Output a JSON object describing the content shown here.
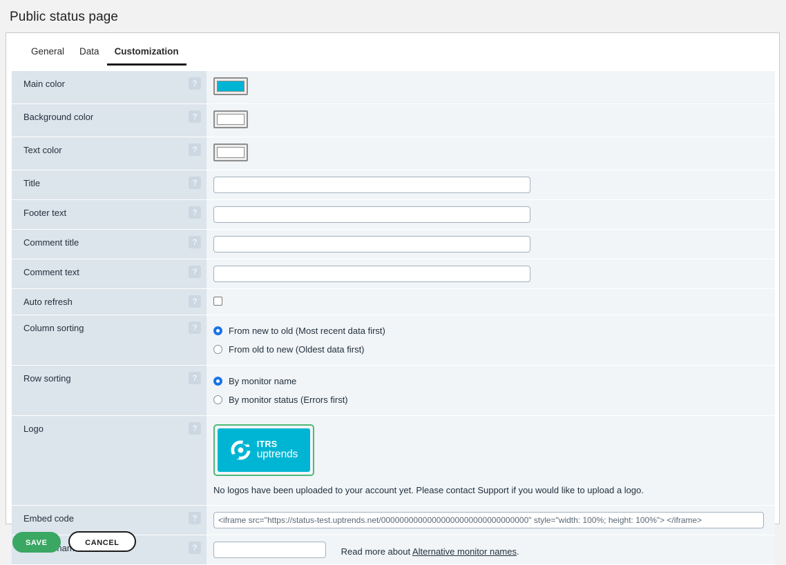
{
  "page": {
    "title": "Public status page"
  },
  "tabs": [
    {
      "label": "General",
      "active": false
    },
    {
      "label": "Data",
      "active": false
    },
    {
      "label": "Customization",
      "active": true
    }
  ],
  "help_icon_glyph": "?",
  "colors": {
    "main_color_value": "#00b5d4",
    "background_color_value": "#ffffff",
    "text_color_value": "#ffffff",
    "accent_green": "#3aa763",
    "radio_blue": "#1a73e8",
    "label_column_bg": "#dce4ec",
    "row_bg": "#f1f5f8"
  },
  "rows": {
    "main_color": {
      "label": "Main color"
    },
    "background_color": {
      "label": "Background color"
    },
    "text_color": {
      "label": "Text color"
    },
    "title": {
      "label": "Title",
      "value": "",
      "placeholder": ""
    },
    "footer_text": {
      "label": "Footer text",
      "value": "",
      "placeholder": ""
    },
    "comment_title": {
      "label": "Comment title",
      "value": "",
      "placeholder": ""
    },
    "comment_text": {
      "label": "Comment text",
      "value": "",
      "placeholder": ""
    },
    "auto_refresh": {
      "label": "Auto refresh",
      "checked": false
    },
    "column_sorting": {
      "label": "Column sorting",
      "options": [
        {
          "label": "From new to old (Most recent data first)",
          "selected": true
        },
        {
          "label": "From old to new (Oldest data first)",
          "selected": false
        }
      ]
    },
    "row_sorting": {
      "label": "Row sorting",
      "options": [
        {
          "label": "By monitor name",
          "selected": true
        },
        {
          "label": "By monitor status (Errors first)",
          "selected": false
        }
      ]
    },
    "logo": {
      "label": "Logo",
      "brand_line1": "ITRS",
      "brand_line2": "uptrends",
      "note": "No logos have been uploaded to your account yet. Please contact Support if you would like to upload a logo."
    },
    "embed_code": {
      "label": "Embed code",
      "value": "<iframe src=\"https://status-test.uptrends.net/00000000000000000000000000000000\" style=\"width: 100%; height: 100%\"> </iframe>"
    },
    "custom_name_field": {
      "label": "Custom name field",
      "value": "",
      "placeholder": "",
      "note_prefix": "Read more about ",
      "note_link": "Alternative monitor names",
      "note_suffix": "."
    }
  },
  "footer": {
    "save_label": "SAVE",
    "cancel_label": "CANCEL"
  }
}
